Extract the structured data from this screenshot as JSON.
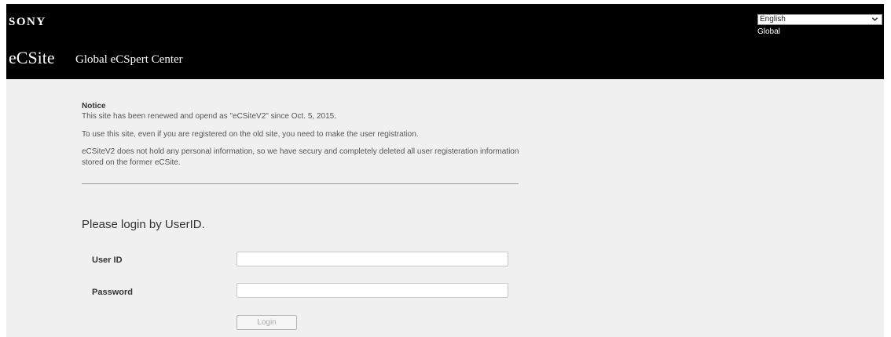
{
  "header": {
    "brand": "SONY",
    "site_name": "eCSite",
    "site_subtitle": "Global eCSpert Center",
    "language": {
      "selected": "English",
      "icon": "chevron-down-icon"
    },
    "region": "Global"
  },
  "notice": {
    "title": "Notice",
    "line1": "This site has been renewed and opend as \"eCSiteV2\" since Oct. 5, 2015.",
    "line2": "To use this site, even if you are registered on the old site, you need to make the user registration.",
    "line3": "eCSiteV2 does not hold any personal information, so we have secury and completely deleted all user registeration information stored on the former eCSite."
  },
  "login": {
    "heading": "Please login by UserID.",
    "user_id_label": "User ID",
    "user_id_value": "",
    "password_label": "Password",
    "password_value": "",
    "button_label": "Login"
  },
  "colors": {
    "header_bg": "#000000",
    "content_bg": "#f0f0f0"
  }
}
